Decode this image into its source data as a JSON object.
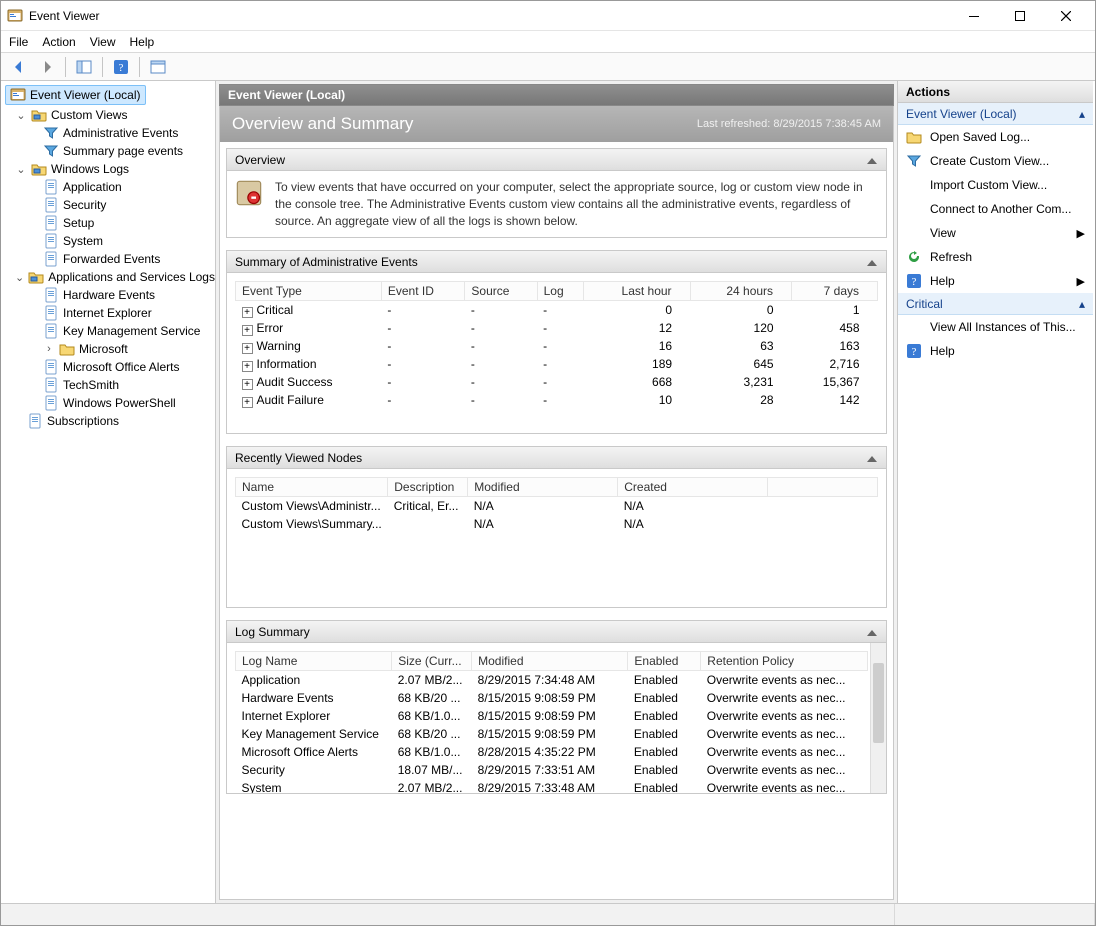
{
  "window": {
    "title": "Event Viewer"
  },
  "menubar": [
    "File",
    "Action",
    "View",
    "Help"
  ],
  "tree": {
    "root": "Event Viewer (Local)",
    "custom_views": {
      "label": "Custom Views",
      "items": [
        "Administrative Events",
        "Summary page events"
      ]
    },
    "windows_logs": {
      "label": "Windows Logs",
      "items": [
        "Application",
        "Security",
        "Setup",
        "System",
        "Forwarded Events"
      ]
    },
    "apps_logs": {
      "label": "Applications and Services Logs",
      "items": [
        "Hardware Events",
        "Internet Explorer",
        "Key Management Service",
        "Microsoft",
        "Microsoft Office Alerts",
        "TechSmith",
        "Windows PowerShell"
      ]
    },
    "subscriptions": "Subscriptions"
  },
  "center": {
    "header": "Event Viewer (Local)",
    "overview_title": "Overview and Summary",
    "last_refreshed_label": "Last refreshed: 8/29/2015 7:38:45 AM",
    "overview_section_title": "Overview",
    "overview_text": "To view events that have occurred on your computer, select the appropriate source, log or custom view node in the console tree. The Administrative Events custom view contains all the administrative events, regardless of source. An aggregate view of all the logs is shown below.",
    "summary_section_title": "Summary of Administrative Events",
    "summary_headers": [
      "Event Type",
      "Event ID",
      "Source",
      "Log",
      "Last hour",
      "24 hours",
      "7 days"
    ],
    "summary_rows": [
      {
        "type": "Critical",
        "last_hour": "0",
        "h24": "0",
        "d7": "1"
      },
      {
        "type": "Error",
        "last_hour": "12",
        "h24": "120",
        "d7": "458"
      },
      {
        "type": "Warning",
        "last_hour": "16",
        "h24": "63",
        "d7": "163"
      },
      {
        "type": "Information",
        "last_hour": "189",
        "h24": "645",
        "d7": "2,716"
      },
      {
        "type": "Audit Success",
        "last_hour": "668",
        "h24": "3,231",
        "d7": "15,367"
      },
      {
        "type": "Audit Failure",
        "last_hour": "10",
        "h24": "28",
        "d7": "142"
      }
    ],
    "dash": "-",
    "recent_section_title": "Recently Viewed Nodes",
    "recent_headers": [
      "Name",
      "Description",
      "Modified",
      "Created"
    ],
    "recent_rows": [
      {
        "name": "Custom Views\\Administr...",
        "desc": "Critical, Er...",
        "modified": "N/A",
        "created": "N/A"
      },
      {
        "name": "Custom Views\\Summary...",
        "desc": "",
        "modified": "N/A",
        "created": "N/A"
      }
    ],
    "log_section_title": "Log Summary",
    "log_headers": [
      "Log Name",
      "Size (Curr...",
      "Modified",
      "Enabled",
      "Retention Policy"
    ],
    "log_rows": [
      {
        "name": "Application",
        "size": "2.07 MB/2...",
        "modified": "8/29/2015 7:34:48 AM",
        "enabled": "Enabled",
        "retention": "Overwrite events as nec..."
      },
      {
        "name": "Hardware Events",
        "size": "68 KB/20 ...",
        "modified": "8/15/2015 9:08:59 PM",
        "enabled": "Enabled",
        "retention": "Overwrite events as nec..."
      },
      {
        "name": "Internet Explorer",
        "size": "68 KB/1.0...",
        "modified": "8/15/2015 9:08:59 PM",
        "enabled": "Enabled",
        "retention": "Overwrite events as nec..."
      },
      {
        "name": "Key Management Service",
        "size": "68 KB/20 ...",
        "modified": "8/15/2015 9:08:59 PM",
        "enabled": "Enabled",
        "retention": "Overwrite events as nec..."
      },
      {
        "name": "Microsoft Office Alerts",
        "size": "68 KB/1.0...",
        "modified": "8/28/2015 4:35:22 PM",
        "enabled": "Enabled",
        "retention": "Overwrite events as nec..."
      },
      {
        "name": "Security",
        "size": "18.07 MB/...",
        "modified": "8/29/2015 7:33:51 AM",
        "enabled": "Enabled",
        "retention": "Overwrite events as nec..."
      },
      {
        "name": "System",
        "size": "2.07 MB/2...",
        "modified": "8/29/2015 7:33:48 AM",
        "enabled": "Enabled",
        "retention": "Overwrite events as nec..."
      }
    ]
  },
  "actions": {
    "header": "Actions",
    "section1": "Event Viewer (Local)",
    "items1": [
      {
        "label": "Open Saved Log...",
        "icon": "folder"
      },
      {
        "label": "Create Custom View...",
        "icon": "filter"
      },
      {
        "label": "Import Custom View...",
        "icon": ""
      },
      {
        "label": "Connect to Another Com...",
        "icon": ""
      },
      {
        "label": "View",
        "icon": "",
        "submenu": true
      },
      {
        "label": "Refresh",
        "icon": "refresh"
      },
      {
        "label": "Help",
        "icon": "help",
        "submenu": true
      }
    ],
    "section2": "Critical",
    "items2": [
      {
        "label": "View All Instances of This...",
        "icon": ""
      },
      {
        "label": "Help",
        "icon": "help"
      }
    ]
  }
}
